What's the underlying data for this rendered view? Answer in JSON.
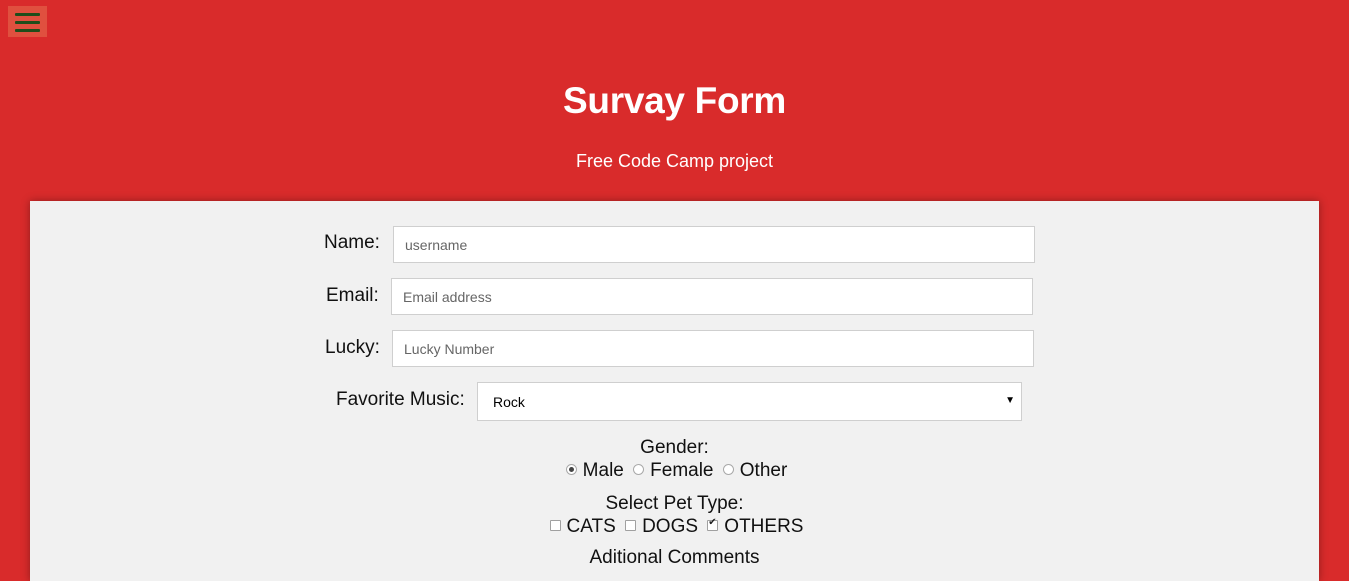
{
  "header": {
    "title": "Survay Form",
    "subtitle": "Free Code Camp project"
  },
  "menu": {
    "icon": "hamburger-menu-icon"
  },
  "form": {
    "name": {
      "label": "Name:",
      "placeholder": "username",
      "value": ""
    },
    "email": {
      "label": "Email:",
      "placeholder": "Email address",
      "value": ""
    },
    "lucky": {
      "label": "Lucky:",
      "placeholder": "Lucky Number",
      "value": ""
    },
    "music": {
      "label": "Favorite Music:",
      "selected": "Rock"
    },
    "gender": {
      "title": "Gender:",
      "options": [
        "Male",
        "Female",
        "Other"
      ],
      "selected": "Male"
    },
    "pets": {
      "title": "Select Pet Type:",
      "options": [
        "CATS",
        "DOGS",
        "OTHERS"
      ],
      "checked": [
        "OTHERS"
      ]
    },
    "comments": {
      "title": "Aditional Comments"
    }
  },
  "colors": {
    "background": "#d92b2b",
    "card": "#f1f1f1",
    "menu_button": "#e0503f",
    "menu_bars": "#1f4d1a"
  }
}
